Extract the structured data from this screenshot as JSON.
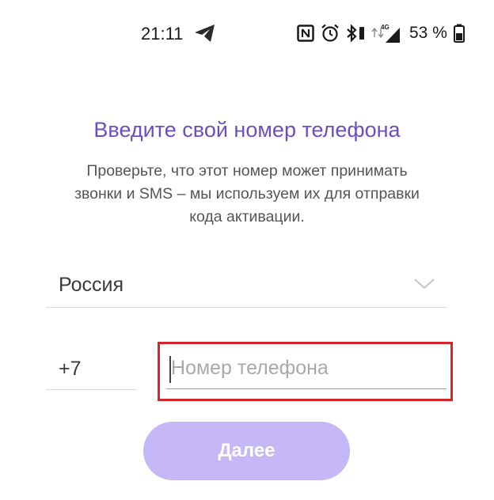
{
  "status_bar": {
    "time": "21:11",
    "battery_percent": "53 %",
    "network_label": "4G",
    "icons": [
      "telegram-icon",
      "nfc-icon",
      "alarm-icon",
      "bluetooth-icon",
      "vibrate-icon",
      "network-icon",
      "battery-icon"
    ]
  },
  "screen": {
    "title": "Введите свой номер телефона",
    "subtitle_lines": [
      "Проверьте, что этот номер может принимать",
      "звонки и SMS – мы используем их для отправки",
      "кода активации."
    ]
  },
  "form": {
    "country": "Россия",
    "country_code": "+7",
    "phone_placeholder": "Номер телефона",
    "phone_value": ""
  },
  "next_button": {
    "label": "Далее",
    "enabled": false
  },
  "colors": {
    "title": "#6a4fc4",
    "button": "#c6b8f6",
    "highlight": "#d8242a"
  }
}
